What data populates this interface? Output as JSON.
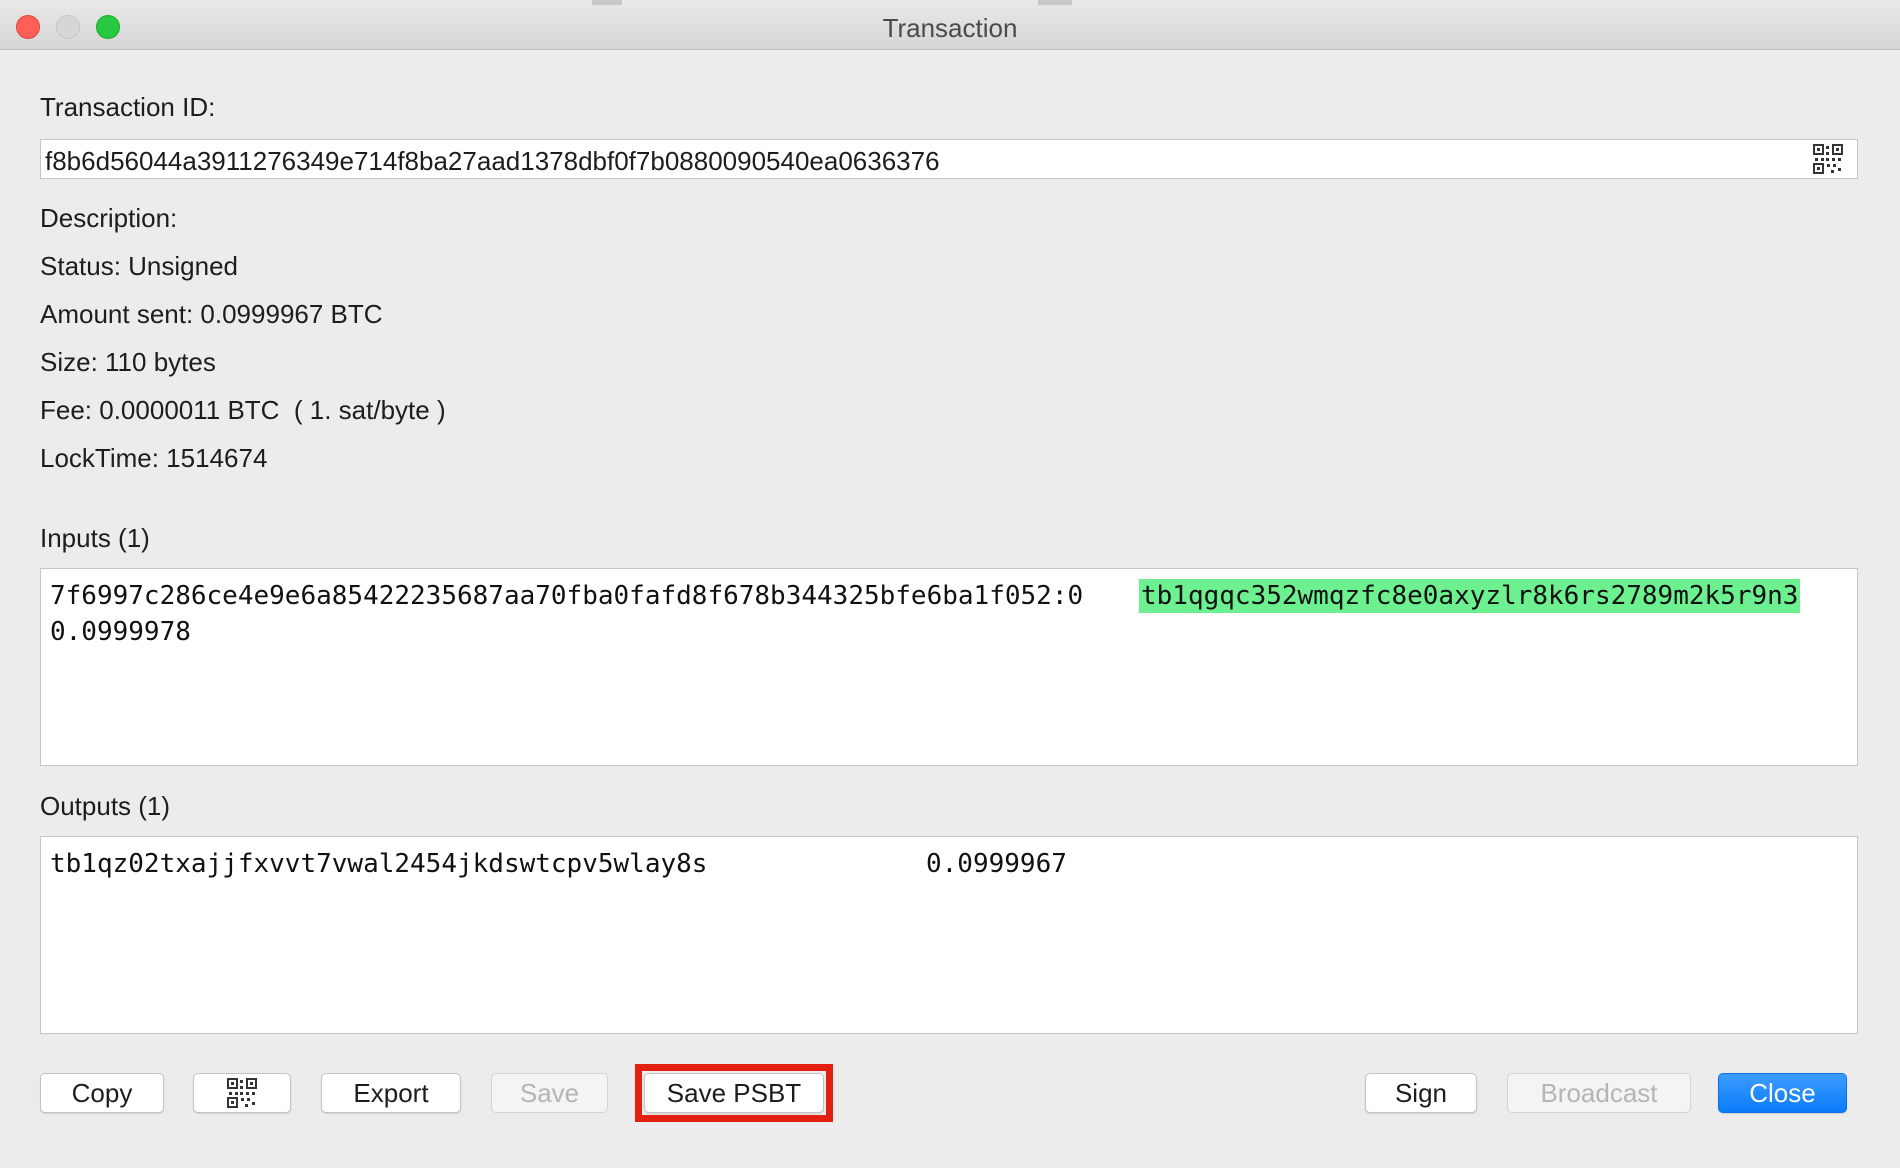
{
  "window": {
    "title": "Transaction"
  },
  "fields": {
    "txid_label": "Transaction ID:",
    "txid_value": "f8b6d56044a3911276349e714f8ba27aad1378dbf0f7b0880090540ea0636376",
    "description": "Description:",
    "status": "Status: Unsigned",
    "amount_sent": "Amount sent: 0.0999967 BTC",
    "size": "Size: 110 bytes",
    "fee": "Fee: 0.0000011 BTC  ( 1. sat/byte )",
    "locktime": "LockTime: 1514674"
  },
  "inputs": {
    "label": "Inputs (1)",
    "rows": [
      {
        "outpoint": "7f6997c286ce4e9e6a85422235687aa70fba0fafd8f678b344325bfe6ba1f052:0",
        "address": "tb1qgqc352wmqzfc8e0axyzlr8k6rs2789m2k5r9n3",
        "amount": "0.0999978"
      }
    ]
  },
  "outputs": {
    "label": "Outputs (1)",
    "rows": [
      {
        "address": "tb1qz02txajjfxvvt7vwal2454jkdswtcpv5wlay8s",
        "amount": "0.0999967"
      }
    ]
  },
  "buttons": {
    "copy": "Copy",
    "export": "Export",
    "save": "Save",
    "save_psbt": "Save PSBT",
    "sign": "Sign",
    "broadcast": "Broadcast",
    "close": "Close"
  },
  "icons": {
    "qr": "qr-code-icon"
  },
  "colors": {
    "highlight_address": "#6df08f",
    "annotation_box": "#e21f10",
    "primary_button": "#0a7cf9"
  }
}
